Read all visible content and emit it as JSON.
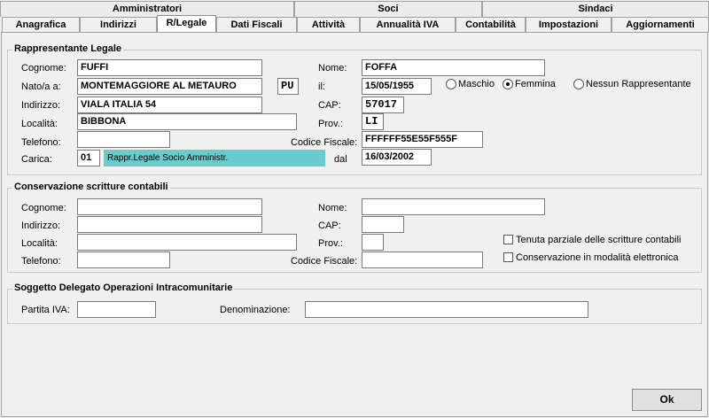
{
  "tabs_top": [
    "Amministratori",
    "Soci",
    "Sindaci"
  ],
  "tabs": [
    "Anagrafica",
    "Indirizzi",
    "R/Legale",
    "Dati Fiscali",
    "Attività",
    "Annualità IVA",
    "Contabilità",
    "Impostazioni",
    "Aggiornamenti"
  ],
  "active_tab": "R/Legale",
  "rappresentante": {
    "title": "Rappresentante Legale",
    "cognome_label": "Cognome:",
    "cognome": "FUFFI",
    "nome_label": "Nome:",
    "nome": "FOFFA",
    "nato_label": "Nato/a a:",
    "nato": "MONTEMAGGIORE AL METAURO",
    "nato_prov": "PU",
    "il_label": "il:",
    "il": "15/05/1955",
    "sesso_options": [
      "Maschio",
      "Femmina",
      "Nessun Rappresentante"
    ],
    "sesso_selected": "Femmina",
    "indirizzo_label": "Indirizzo:",
    "indirizzo": "VIALA ITALIA 54",
    "cap_label": "CAP:",
    "cap": "57017",
    "localita_label": "Località:",
    "localita": "BIBBONA",
    "prov_label": "Prov.:",
    "prov": "LI",
    "telefono_label": "Telefono:",
    "telefono": "",
    "cf_label": "Codice Fiscale:",
    "cf": "FFFFFF55E55F555F",
    "carica_label": "Carica:",
    "carica_code": "01",
    "carica_desc": "Rappr.Legale Socio Amministr.",
    "dal_label": "dal",
    "dal": "16/03/2002"
  },
  "conservazione": {
    "title": "Conservazione scritture contabili",
    "cognome_label": "Cognome:",
    "nome_label": "Nome:",
    "indirizzo_label": "Indirizzo:",
    "cap_label": "CAP:",
    "localita_label": "Località:",
    "prov_label": "Prov.:",
    "telefono_label": "Telefono:",
    "cf_label": "Codice Fiscale:",
    "chk_tenuta": "Tenuta parziale delle scritture contabili",
    "chk_elettronica": "Conservazione in modalità elettronica"
  },
  "delegato": {
    "title": "Soggetto Delegato Operazioni Intracomunitarie",
    "piva_label": "Partita IVA:",
    "denominazione_label": "Denominazione:"
  },
  "ok_label": "Ok"
}
